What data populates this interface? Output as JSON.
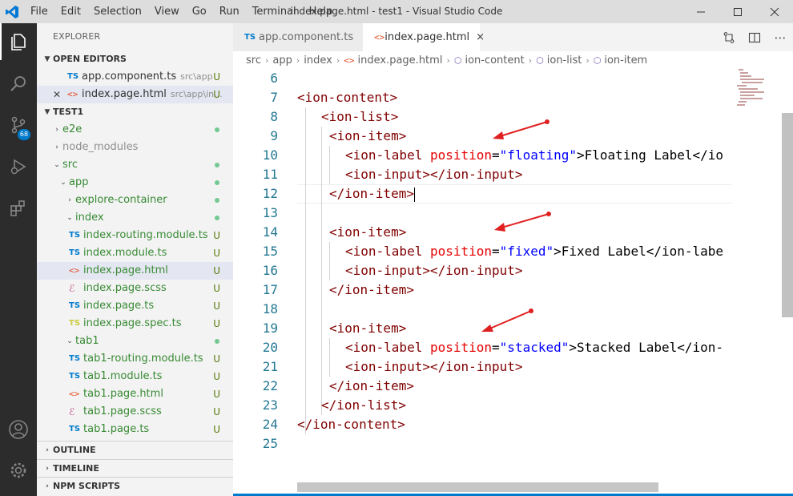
{
  "window": {
    "title": "index.page.html - test1 - Visual Studio Code",
    "menu": [
      "File",
      "Edit",
      "Selection",
      "View",
      "Go",
      "Run",
      "Terminal",
      "Help"
    ]
  },
  "activity_bar": {
    "items": [
      "files-icon",
      "search-icon",
      "source-control-icon",
      "run-debug-icon",
      "extensions-icon",
      "account-icon",
      "manage-gear-icon"
    ],
    "source_control_badge": "68"
  },
  "sidebar": {
    "title": "EXPLORER",
    "open_editors": {
      "label": "OPEN EDITORS",
      "items": [
        {
          "icon": "TS",
          "name": "app.component.ts",
          "path": "src\\app",
          "status": "U"
        },
        {
          "icon": "<>",
          "name": "index.page.html",
          "path": "src\\app\\in...",
          "status": "U"
        }
      ]
    },
    "project": {
      "label": "TEST1",
      "items": [
        {
          "name": "e2e",
          "status": "dot"
        },
        {
          "name": "node_modules",
          "status": ""
        },
        {
          "name": "src",
          "status": "dot"
        },
        {
          "name": "app",
          "status": "dot"
        },
        {
          "name": "explore-container",
          "status": "dot"
        },
        {
          "name": "index",
          "status": "dot"
        },
        {
          "icon": "TS",
          "name": "index-routing.module.ts",
          "status": "U"
        },
        {
          "icon": "TS",
          "name": "index.module.ts",
          "status": "U"
        },
        {
          "icon": "<>",
          "name": "index.page.html",
          "status": "U"
        },
        {
          "icon": "scss",
          "name": "index.page.scss",
          "status": "U"
        },
        {
          "icon": "TS",
          "name": "index.page.ts",
          "status": "U"
        },
        {
          "icon": "TS",
          "name": "index.page.spec.ts",
          "status": "U"
        },
        {
          "name": "tab1",
          "status": "dot"
        },
        {
          "icon": "TS",
          "name": "tab1-routing.module.ts",
          "status": "U"
        },
        {
          "icon": "TS",
          "name": "tab1.module.ts",
          "status": "U"
        },
        {
          "icon": "<>",
          "name": "tab1.page.html",
          "status": "U"
        },
        {
          "icon": "scss",
          "name": "tab1.page.scss",
          "status": "U"
        },
        {
          "icon": "TS",
          "name": "tab1.page.ts",
          "status": "U"
        }
      ]
    },
    "sections": [
      "OUTLINE",
      "TIMELINE",
      "NPM SCRIPTS"
    ]
  },
  "tabs": [
    {
      "icon": "TS",
      "label": "app.component.ts",
      "active": false
    },
    {
      "icon": "<>",
      "label": "index.page.html",
      "active": true,
      "close": "×"
    }
  ],
  "breadcrumbs": [
    "src",
    "app",
    "index",
    "index.page.html",
    "ion-content",
    "ion-list",
    "ion-item"
  ],
  "editor": {
    "line_numbers": [
      "6",
      "7",
      "8",
      "9",
      "10",
      "11",
      "12",
      "13",
      "14",
      "15",
      "16",
      "17",
      "18",
      "19",
      "20",
      "21",
      "22",
      "23",
      "24",
      "25"
    ],
    "lines": {
      "l7": "<ion-content>",
      "l8": "<ion-list>",
      "l9": "<ion-item>",
      "l10_tag": "<ion-label ",
      "l10_attr": "position",
      "l10_val": "\"floating\"",
      "l10_rest": ">Floating Label</io",
      "l11": "<ion-input></ion-input>",
      "l12": "</ion-item>",
      "l14": "<ion-item>",
      "l15_tag": "<ion-label ",
      "l15_attr": "position",
      "l15_val": "\"fixed\"",
      "l15_rest": ">Fixed Label</ion-labe",
      "l16": "<ion-input></ion-input>",
      "l17": "</ion-item>",
      "l19": "<ion-item>",
      "l20_tag": "<ion-label ",
      "l20_attr": "position",
      "l20_val": "\"stacked\"",
      "l20_rest": ">Stacked Label</ion-",
      "l21": "<ion-input></ion-input>",
      "l22": "</ion-item>",
      "l23": "</ion-list>",
      "l24": "</ion-content>"
    }
  },
  "colors": {
    "accent": "#007acc",
    "annotation_arrow": "#e02020",
    "tag": "#800000",
    "attribute": "#e50000",
    "string": "#0000ff"
  }
}
